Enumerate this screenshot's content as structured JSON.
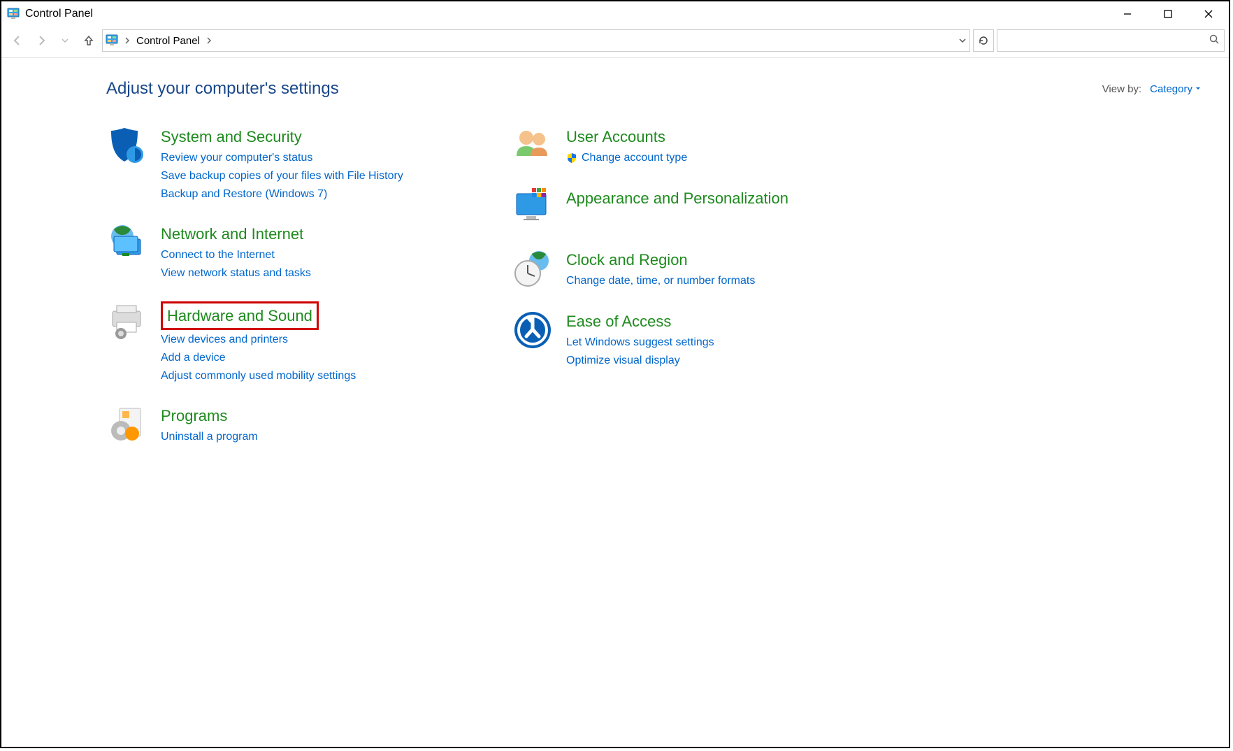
{
  "window": {
    "title": "Control Panel"
  },
  "breadcrumb": {
    "root": "Control Panel"
  },
  "header": {
    "title": "Adjust your computer's settings",
    "viewby_label": "View by:",
    "viewby_value": "Category"
  },
  "left": {
    "system": {
      "title": "System and Security",
      "links": {
        "l0": "Review your computer's status",
        "l1": "Save backup copies of your files with File History",
        "l2": "Backup and Restore (Windows 7)"
      }
    },
    "network": {
      "title": "Network and Internet",
      "links": {
        "l0": "Connect to the Internet",
        "l1": "View network status and tasks"
      }
    },
    "hardware": {
      "title": "Hardware and Sound",
      "links": {
        "l0": "View devices and printers",
        "l1": "Add a device",
        "l2": "Adjust commonly used mobility settings"
      }
    },
    "programs": {
      "title": "Programs",
      "links": {
        "l0": "Uninstall a program"
      }
    }
  },
  "right": {
    "users": {
      "title": "User Accounts",
      "links": {
        "l0": "Change account type"
      }
    },
    "appearance": {
      "title": "Appearance and Personalization"
    },
    "clock": {
      "title": "Clock and Region",
      "links": {
        "l0": "Change date, time, or number formats"
      }
    },
    "ease": {
      "title": "Ease of Access",
      "links": {
        "l0": "Let Windows suggest settings",
        "l1": "Optimize visual display"
      }
    }
  }
}
